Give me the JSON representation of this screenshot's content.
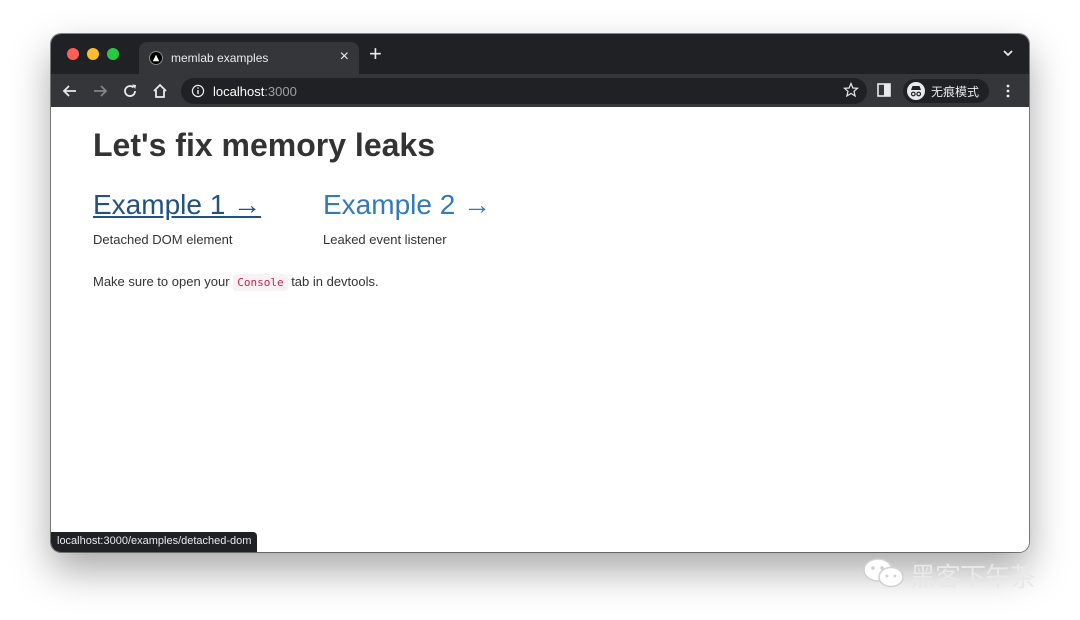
{
  "browser": {
    "tab": {
      "title": "memlab examples",
      "close_glyph": "×",
      "favicon": "triangle-logo-icon"
    },
    "new_tab_glyph": "+",
    "url": {
      "host": "localhost",
      "port": ":3000"
    },
    "incognito_label": "无痕模式",
    "status_url": "localhost:3000/examples/detached-dom",
    "colors": {
      "frame": "#202124",
      "toolbar": "#35363a"
    }
  },
  "page": {
    "title": "Let's fix memory leaks",
    "examples": [
      {
        "label": "Example 1 →",
        "description": "Detached DOM element"
      },
      {
        "label": "Example 2 →",
        "description": "Leaked event listener"
      }
    ],
    "note": {
      "before": "Make sure to open your",
      "code": "Console",
      "after": "tab in devtools."
    },
    "colors": {
      "link": "#337ab7",
      "link_hover": "#23527c",
      "text": "#333333",
      "code": "#c7254e"
    }
  },
  "watermark": {
    "text": "黑客下午茶",
    "icon": "wechat-icon"
  }
}
